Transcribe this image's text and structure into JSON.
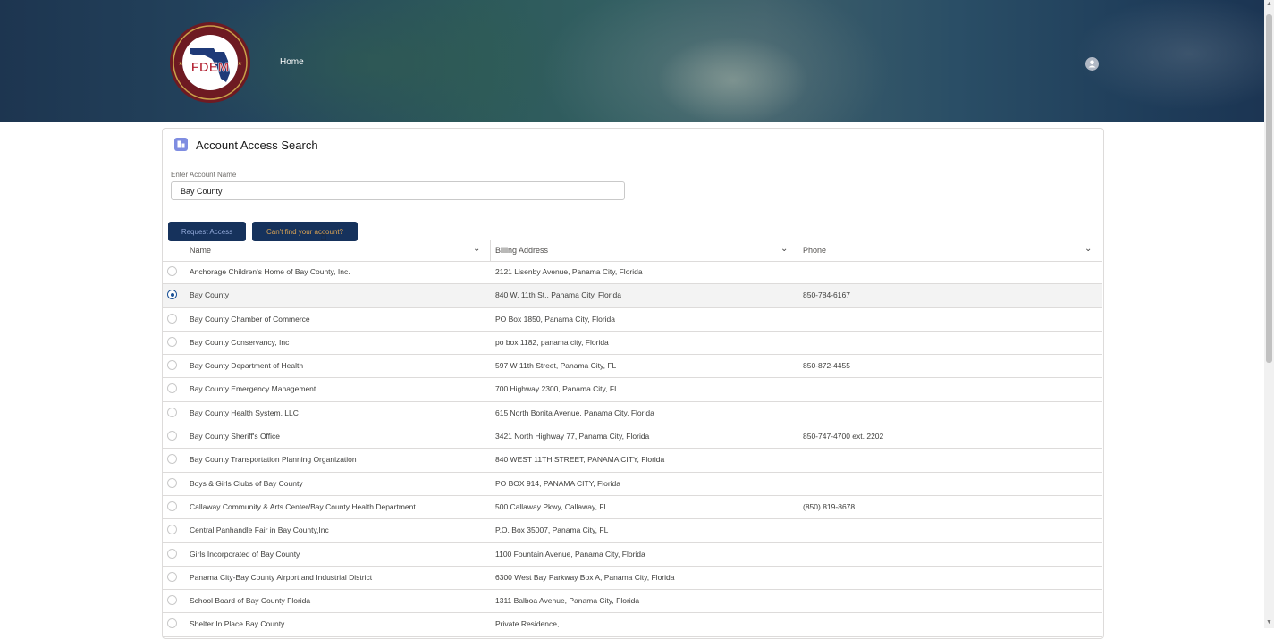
{
  "header": {
    "logo_text": "FDEM",
    "logo_ring_text": "DIVISION OF EMERGENCY MANAGEMENT · OFFICE OF THE GOVERNOR",
    "nav_home": "Home",
    "user_icon": "user-avatar-icon"
  },
  "card": {
    "icon": "account-access-icon",
    "title": "Account Access Search",
    "field_label": "Enter Account Name",
    "field_value": "Bay County",
    "request_access_label": "Request Access",
    "cant_find_label": "Can't find your account?"
  },
  "table": {
    "columns": [
      "Name",
      "Billing Address",
      "Phone"
    ],
    "rows": [
      {
        "name": "Anchorage Children's Home of Bay County, Inc.",
        "address": "2121 Lisenby Avenue, Panama City, Florida",
        "phone": ""
      },
      {
        "name": "Bay County",
        "address": "840 W. 11th St., Panama City, Florida",
        "phone": "850-784-6167",
        "selected": true
      },
      {
        "name": "Bay County Chamber of Commerce",
        "address": "PO Box 1850, Panama City, Florida",
        "phone": ""
      },
      {
        "name": "Bay County Conservancy, Inc",
        "address": "po box 1182, panama city, Florida",
        "phone": ""
      },
      {
        "name": "Bay County Department of Health",
        "address": "597 W 11th Street, Panama City, FL",
        "phone": "850-872-4455"
      },
      {
        "name": "Bay County Emergency Management",
        "address": "700 Highway 2300, Panama City, FL",
        "phone": ""
      },
      {
        "name": "Bay County Health System, LLC",
        "address": "615 North Bonita Avenue, Panama City, Florida",
        "phone": ""
      },
      {
        "name": "Bay County Sheriff's Office",
        "address": "3421 North Highway 77, Panama City, Florida",
        "phone": "850-747-4700 ext. 2202"
      },
      {
        "name": "Bay County Transportation Planning Organization",
        "address": "840 WEST 11TH STREET, PANAMA CITY, Florida",
        "phone": ""
      },
      {
        "name": "Boys & Girls Clubs of Bay County",
        "address": "PO BOX 914, PANAMA CITY, Florida",
        "phone": ""
      },
      {
        "name": "Callaway Community & Arts Center/Bay County Health Department",
        "address": "500 Callaway Pkwy, Callaway, FL",
        "phone": "(850) 819-8678"
      },
      {
        "name": "Central Panhandle Fair in Bay County,Inc",
        "address": "P.O. Box 35007, Panama City, FL",
        "phone": ""
      },
      {
        "name": "Girls Incorporated of Bay County",
        "address": "1100 Fountain Avenue, Panama City, Florida",
        "phone": ""
      },
      {
        "name": "Panama City-Bay County Airport and Industrial District",
        "address": "6300 West Bay Parkway Box A, Panama City, Florida",
        "phone": ""
      },
      {
        "name": "School Board of Bay County Florida",
        "address": "1311 Balboa Avenue, Panama City, Florida",
        "phone": ""
      },
      {
        "name": "Shelter In Place Bay County",
        "address": "Private Residence,",
        "phone": ""
      }
    ]
  },
  "colors": {
    "button_bg": "#16325c",
    "button_text": "#d9a253",
    "selected_radio": "#1b5297"
  }
}
